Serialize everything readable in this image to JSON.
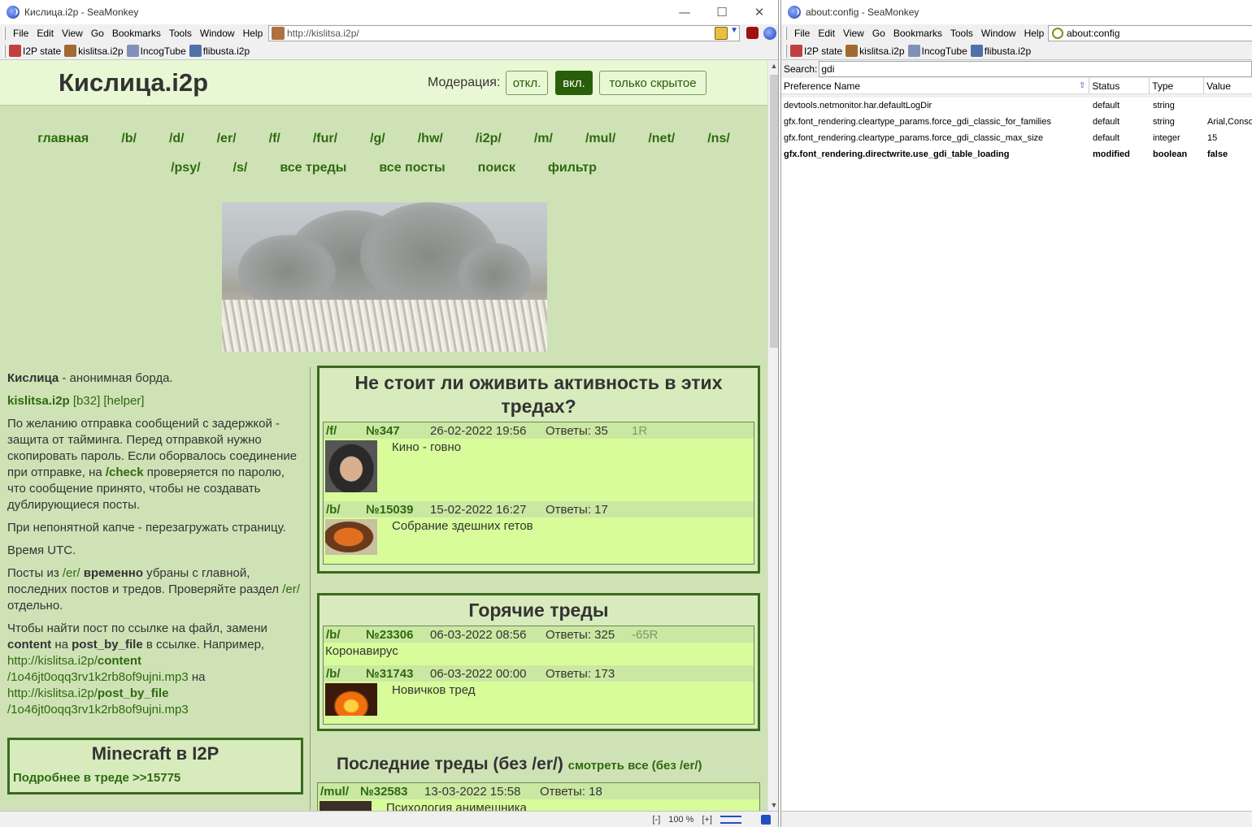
{
  "left_window": {
    "title": "Кислица.i2p - SeaMonkey",
    "menu": [
      "File",
      "Edit",
      "View",
      "Go",
      "Bookmarks",
      "Tools",
      "Window",
      "Help"
    ],
    "url": "http://kislitsa.i2p/",
    "bookmarks": [
      "I2P state",
      "kislitsa.i2p",
      "IncogTube",
      "flibusta.i2p"
    ],
    "status": {
      "minus": "[-]",
      "zoom": "100 %",
      "plus": "[+]"
    }
  },
  "right_window": {
    "title": "about:config - SeaMonkey",
    "menu": [
      "File",
      "Edit",
      "View",
      "Go",
      "Bookmarks",
      "Tools",
      "Window",
      "Help"
    ],
    "url": "about:config",
    "bookmarks": [
      "I2P state",
      "kislitsa.i2p",
      "IncogTube",
      "flibusta.i2p"
    ],
    "search_label": "Search:",
    "search_value": "gdi",
    "columns": [
      "Preference Name",
      "Status",
      "Type",
      "Value"
    ],
    "prefs": [
      {
        "name": "devtools.netmonitor.har.defaultLogDir",
        "status": "default",
        "type": "string",
        "value": "",
        "bold": false
      },
      {
        "name": "gfx.font_rendering.cleartype_params.force_gdi_classic_for_families",
        "status": "default",
        "type": "string",
        "value": "Arial,Conso",
        "bold": false
      },
      {
        "name": "gfx.font_rendering.cleartype_params.force_gdi_classic_max_size",
        "status": "default",
        "type": "integer",
        "value": "15",
        "bold": false
      },
      {
        "name": "gfx.font_rendering.directwrite.use_gdi_table_loading",
        "status": "modified",
        "type": "boolean",
        "value": "false",
        "bold": true
      }
    ]
  },
  "site": {
    "title": "Кислица.i2p",
    "moderation_label": "Модерация:",
    "moderation_buttons": [
      "откл.",
      "вкл.",
      "только скрытое"
    ],
    "nav_row1": [
      "главная",
      "/b/",
      "/d/",
      "/er/",
      "/f/",
      "/fur/",
      "/g/",
      "/hw/",
      "/i2p/",
      "/m/",
      "/mul/",
      "/net/",
      "/ns/"
    ],
    "nav_row2": [
      "/psy/",
      "/s/",
      "все треды",
      "все посты",
      "поиск",
      "фильтр"
    ],
    "left": {
      "p1_bold": "Кислица",
      "p1_rest": " - анонимная борда.",
      "p2_link": "kislitsa.i2p",
      "p2_b32": " [b32]",
      "p2_helper": " [helper]",
      "p3_a": "По желанию отправка сообщений с задержкой - защита от тайминга. Перед отправкой нужно скопировать пароль. Если оборвалось соединение при отправке, на ",
      "p3_link": "/check",
      "p3_b": " проверяется по паролю, что сообщение принято, чтобы не создавать дублирующиеся посты.",
      "p4": "При непонятной капче - перезагружать страницу.",
      "p5": "Время UTC.",
      "p6_a": "Посты из ",
      "p6_link": "/er/",
      "p6_bold": " временно",
      "p6_b": " убраны с главной, последних постов и тредов. Проверяйте раздел ",
      "p6_link2": "/er/",
      "p6_c": " отдельно.",
      "p7_a": "Чтобы найти пост по ссылке на файл, замени ",
      "p7_b1": "content",
      "p7_b": " на ",
      "p7_b2": "post_by_file",
      "p7_c": " в ссылке. Например,",
      "ex1_a": "http://kislitsa.i2p/",
      "ex1_b": "content",
      "ex1_c": "/1o46jt0oqq3rv1k2rb8of9ujni.mp3",
      "ex_mid": " на",
      "ex2_a": "http://kislitsa.i2p/",
      "ex2_b": "post_by_file",
      "ex2_c": "/1o46jt0oqq3rv1k2rb8of9ujni.mp3",
      "mc_title": "Minecraft в I2P",
      "mc_link": "Подробнее в треде >>15775"
    },
    "box1": {
      "title": "Не стоит ли оживить активность в этих тредах?",
      "threads": [
        {
          "board": "/f/",
          "num": "№347",
          "date": "26-02-2022 19:56",
          "replies": "Ответы: 35",
          "extra": "1R",
          "text": "Кино - говно"
        },
        {
          "board": "/b/",
          "num": "№15039",
          "date": "15-02-2022 16:27",
          "replies": "Ответы: 17",
          "extra": "",
          "text": "Собрание здешних гетов"
        }
      ]
    },
    "box2": {
      "title": "Горячие треды",
      "threads": [
        {
          "board": "/b/",
          "num": "№23306",
          "date": "06-03-2022 08:56",
          "replies": "Ответы: 325",
          "extra": "-65R",
          "text": "Коронавирус"
        },
        {
          "board": "/b/",
          "num": "№31743",
          "date": "06-03-2022 00:00",
          "replies": "Ответы: 173",
          "extra": "",
          "text": "Новичков тред"
        }
      ]
    },
    "last": {
      "title": "Последние треды (без /er/)",
      "see_all": "смотреть все (без /er/)",
      "thread": {
        "board": "/mul/",
        "num": "№32583",
        "date": "13-03-2022 15:58",
        "replies": "Ответы: 18",
        "text": "Психология анимешника"
      }
    }
  }
}
